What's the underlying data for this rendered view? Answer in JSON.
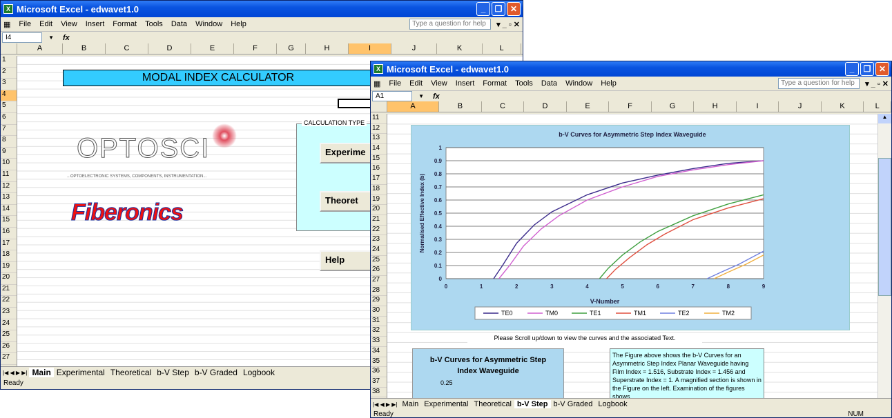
{
  "window1": {
    "title": "Microsoft Excel - edwavet1.0",
    "menu": [
      "File",
      "Edit",
      "View",
      "Insert",
      "Format",
      "Tools",
      "Data",
      "Window",
      "Help"
    ],
    "help_placeholder": "Type a question for help",
    "cell_ref": "I4",
    "columns": [
      "A",
      "B",
      "C",
      "D",
      "E",
      "F",
      "G",
      "H",
      "I",
      "J",
      "K",
      "L"
    ],
    "rows": [
      "1",
      "2",
      "3",
      "4",
      "5",
      "6",
      "7",
      "8",
      "9",
      "10",
      "11",
      "12",
      "13",
      "14",
      "15",
      "16",
      "17",
      "18",
      "19",
      "20",
      "21",
      "22",
      "23",
      "24",
      "25",
      "26",
      "27"
    ],
    "banner": "MODAL INDEX CALCULATOR",
    "calc_type_label": "CALCULATION TYPE",
    "btn_experimental": "Experime",
    "btn_theoretical": "Theoret",
    "btn_help": "Help",
    "logo_optosci": "OPTOSCI",
    "logo_optosci_sub": "...OPTOELECTRONIC SYSTEMS, COMPONENTS, INSTRUMENTATION...",
    "logo_fiberonics": "Fiberonics",
    "tabs": [
      "Main",
      "Experimental",
      "Theoretical",
      "b-V Step",
      "b-V  Graded",
      "Logbook"
    ],
    "status": "Ready"
  },
  "window2": {
    "title": "Microsoft Excel - edwavet1.0",
    "menu": [
      "File",
      "Edit",
      "View",
      "Insert",
      "Format",
      "Tools",
      "Data",
      "Window",
      "Help"
    ],
    "help_placeholder": "Type a question for help",
    "cell_ref": "A1",
    "columns": [
      "A",
      "B",
      "C",
      "D",
      "E",
      "F",
      "G",
      "H",
      "I",
      "J",
      "K",
      "L"
    ],
    "rows": [
      "11",
      "12",
      "13",
      "14",
      "15",
      "16",
      "17",
      "18",
      "19",
      "20",
      "21",
      "22",
      "23",
      "24",
      "25",
      "26",
      "27",
      "28",
      "29",
      "30",
      "31",
      "32",
      "33",
      "34",
      "35",
      "36",
      "37",
      "38"
    ],
    "scroll_note": "Please Scroll up/down to view the curves and the associated Text.",
    "box_title": "b-V Curves for Asymmetric Step Index Waveguide",
    "box_value": "0.25",
    "description": "The Figure above shows the b-V Curves for an Asymmetric Step Index Planar Waveguide having Film Index = 1.516, Substrate Index = 1.456 and Superstrate Index = 1. A magnified section is shown in the Figure on the left. Examination of the figures shows...",
    "tabs": [
      "Main",
      "Experimental",
      "Theoretical",
      "b-V Step",
      "b-V  Graded",
      "Logbook"
    ],
    "status": "Ready",
    "num": "NUM"
  },
  "chart_data": {
    "type": "line",
    "title": "b-V Curves for Asymmetric Step Index Waveguide",
    "xlabel": "V-Number",
    "ylabel": "Normalised Effective Index (b)",
    "xlim": [
      0,
      9
    ],
    "ylim": [
      0,
      1
    ],
    "xticks": [
      "0",
      "1",
      "2",
      "3",
      "4",
      "5",
      "6",
      "7",
      "8",
      "9"
    ],
    "yticks": [
      "0",
      "0.1",
      "0.2",
      "0.3",
      "0.4",
      "0.5",
      "0.6",
      "0.7",
      "0.8",
      "0.9",
      "1"
    ],
    "grid": true,
    "legend": "bottom",
    "series": [
      {
        "name": "TE0",
        "color": "#3c2c8c",
        "x": [
          1.35,
          1.6,
          2,
          2.5,
          3,
          4,
          5,
          6,
          7,
          8,
          9
        ],
        "y": [
          0,
          0.1,
          0.27,
          0.41,
          0.51,
          0.64,
          0.73,
          0.79,
          0.84,
          0.88,
          0.9
        ]
      },
      {
        "name": "TM0",
        "color": "#d060d0",
        "x": [
          1.5,
          1.8,
          2.2,
          2.7,
          3.2,
          4,
          5,
          6,
          7,
          8,
          9
        ],
        "y": [
          0,
          0.1,
          0.25,
          0.38,
          0.48,
          0.6,
          0.7,
          0.78,
          0.83,
          0.87,
          0.9
        ]
      },
      {
        "name": "TE1",
        "color": "#40a040",
        "x": [
          4.35,
          4.6,
          5,
          5.5,
          6,
          7,
          8,
          9
        ],
        "y": [
          0,
          0.08,
          0.18,
          0.28,
          0.36,
          0.48,
          0.57,
          0.64
        ]
      },
      {
        "name": "TM1",
        "color": "#e05040",
        "x": [
          4.55,
          4.8,
          5.2,
          5.7,
          6.2,
          7,
          8,
          9
        ],
        "y": [
          0,
          0.07,
          0.16,
          0.26,
          0.34,
          0.45,
          0.54,
          0.61
        ]
      },
      {
        "name": "TE2",
        "color": "#7080e0",
        "x": [
          7.4,
          7.8,
          8.3,
          9
        ],
        "y": [
          0,
          0.05,
          0.11,
          0.21
        ]
      },
      {
        "name": "TM2",
        "color": "#f0b040",
        "x": [
          7.6,
          8,
          8.5,
          9
        ],
        "y": [
          0,
          0.05,
          0.11,
          0.18
        ]
      }
    ]
  }
}
